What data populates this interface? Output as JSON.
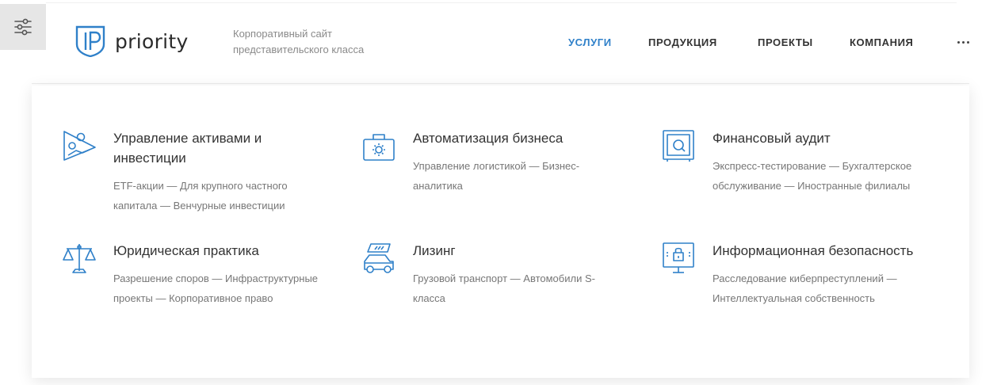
{
  "brand": {
    "name": "priority",
    "tagline": "Корпоративный сайт представительского класса"
  },
  "colors": {
    "accent": "#2f80c9",
    "text": "#333333",
    "muted": "#777777"
  },
  "nav": {
    "items": [
      {
        "label": "УСЛУГИ",
        "active": true
      },
      {
        "label": "ПРОДУКЦИЯ"
      },
      {
        "label": "ПРОЕКТЫ"
      },
      {
        "label": "КОМПАНИЯ"
      }
    ],
    "more_icon": "more-dots-icon"
  },
  "toolbar": {
    "settings_icon": "sliders-icon"
  },
  "services": [
    {
      "icon": "chart-presentation-icon",
      "title": "Управление активами и инвестиции",
      "desc": "ETF-акции — Для крупного частного капитала — Венчурные инвестиции"
    },
    {
      "icon": "briefcase-gear-icon",
      "title": "Автоматизация бизнеса",
      "desc": "Управление логистикой — Бизнес-аналитика"
    },
    {
      "icon": "safe-icon",
      "title": "Финансовый аудит",
      "desc": "Экспресс-тестирование — Бухгалтерское обслуживание — Иностранные филиалы"
    },
    {
      "icon": "scales-icon",
      "title": "Юридическая практика",
      "desc": "Разрешение споров — Инфраструктурные проекты — Корпоративное право"
    },
    {
      "icon": "car-icon",
      "title": "Лизинг",
      "desc": "Грузовой транспорт — Автомобили S-класса"
    },
    {
      "icon": "monitor-lock-icon",
      "title": "Информационная безопасность",
      "desc": "Расследование киберпреступлений — Интеллектуальная собственность"
    }
  ]
}
